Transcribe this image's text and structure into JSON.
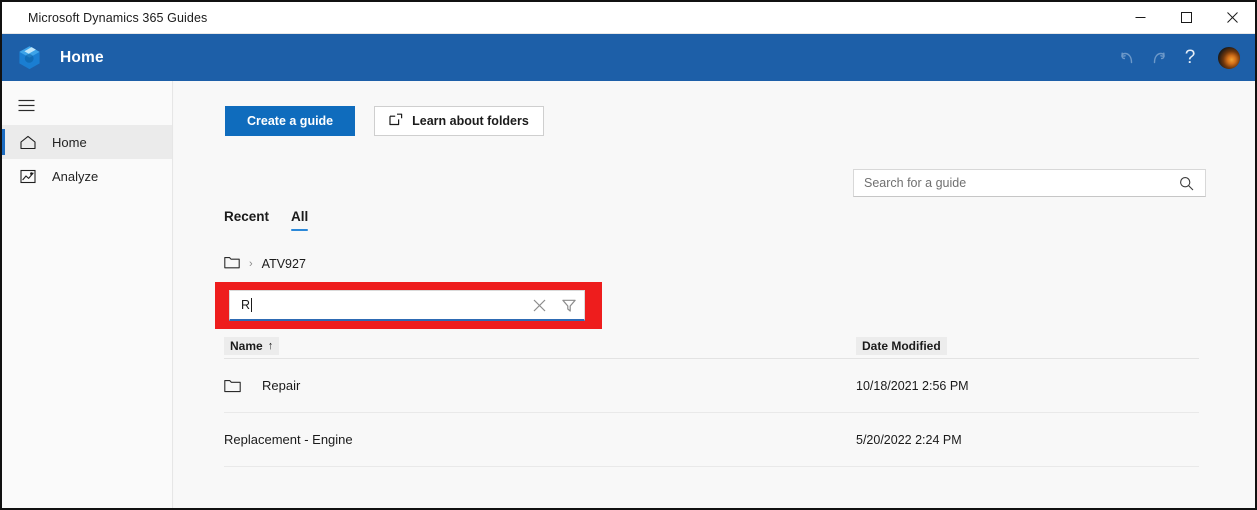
{
  "window": {
    "title": "Microsoft Dynamics 365 Guides",
    "controls": {
      "minimize": "minimize",
      "maximize": "maximize",
      "close": "close"
    }
  },
  "appbar": {
    "title": "Home",
    "logo": "dynamics-365-guides-logo",
    "undo": "undo-icon",
    "redo": "redo-icon",
    "help": "?",
    "avatar": "user-avatar"
  },
  "sidebar": {
    "menu_toggle": "hamburger-icon",
    "items": [
      {
        "label": "Home",
        "icon": "home-icon",
        "selected": true
      },
      {
        "label": "Analyze",
        "icon": "analyze-chart-icon",
        "selected": false
      }
    ]
  },
  "toolbar": {
    "create_guide_label": "Create a guide",
    "learn_folders_label": "Learn about folders",
    "learn_folders_icon": "external-link-icon"
  },
  "search": {
    "placeholder": "Search for a guide",
    "value": "",
    "icon": "search-icon"
  },
  "tabs": [
    {
      "label": "Recent",
      "active": false
    },
    {
      "label": "All",
      "active": true
    }
  ],
  "breadcrumb": {
    "root_icon": "folder-icon",
    "separator": "›",
    "current": "ATV927"
  },
  "filter": {
    "value": "R",
    "placeholder": "",
    "clear_icon": "close-icon",
    "filter_icon": "funnel-filter-icon",
    "highlight_color": "#ee1d1d"
  },
  "table": {
    "columns": [
      {
        "label": "Name",
        "sort": "↑"
      },
      {
        "label": "Date Modified",
        "sort": ""
      }
    ],
    "rows": [
      {
        "icon": "folder-icon",
        "name": "Repair",
        "date": "10/18/2021 2:56 PM"
      },
      {
        "icon": "",
        "name": "Replacement - Engine",
        "date": "5/20/2022 2:24 PM"
      }
    ]
  },
  "colors": {
    "appbar": "#1d5fa8",
    "primary_button": "#0f6cbd",
    "tab_underline": "#2b88d8",
    "focus_underline": "#2e6bb4",
    "highlight": "#ee1d1d"
  }
}
